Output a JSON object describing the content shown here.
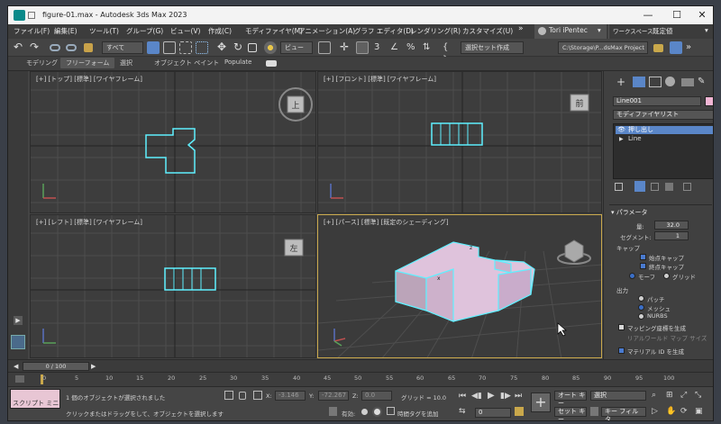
{
  "window": {
    "title": "figure-01.max - Autodesk 3ds Max 2023",
    "minimize": "—",
    "maximize": "☐",
    "close": "✕"
  },
  "menus": [
    "ファイル(F)",
    "編集(E)",
    "ツール(T)",
    "グループ(G)",
    "ビュー(V)",
    "作成(C)",
    "モディファイヤ(M)",
    "アニメーション(A)",
    "グラフ エディタ(D)",
    "レンダリング(R)",
    "カスタマイズ(U)"
  ],
  "menu_overflow": "»",
  "user": {
    "name": "Tori iPentec"
  },
  "workspace": {
    "label": "ワークスペース:",
    "value": "既定値"
  },
  "toolbar": {
    "selection_filter": "すべて",
    "ref_coord": "ビュー",
    "named_selection": "選択セット作成",
    "project_path": "C:\\Storage\\P...dsMax Project"
  },
  "ribbon": {
    "tabs": [
      "モデリング",
      "フリーフォーム",
      "選択",
      "オブジェクト ペイント",
      "Populate"
    ],
    "active": 1
  },
  "viewports": {
    "top": {
      "label": "[+] [トップ] [標準] [ワイヤフレーム]",
      "cube": "上"
    },
    "front": {
      "label": "[+] [フロント] [標準] [ワイヤフレーム]",
      "cube": "前"
    },
    "left": {
      "label": "[+] [レフト] [標準] [ワイヤフレーム]",
      "cube": "左"
    },
    "persp": {
      "label": "[+] [パース] [標準] [既定のシェーディング]"
    }
  },
  "command_panel": {
    "object_name": "Line001",
    "object_color": "#f2b5d4",
    "modifier_list": "モディファイヤリスト",
    "stack": [
      {
        "label": "押し出し",
        "selected": true
      },
      {
        "label": "Line",
        "selected": false
      }
    ],
    "rollout_title": "パラメータ",
    "amount_label": "量:",
    "amount_value": "32.0",
    "segments_label": "セグメント:",
    "segments_value": "1",
    "capping_label": "キャップ",
    "cap_start": "始点キャップ",
    "cap_end": "終点キャップ",
    "morph": "モーフ",
    "grid": "グリッド",
    "output_label": "出力",
    "patch": "パッチ",
    "mesh": "メッシュ",
    "nurbs": "NURBS",
    "gen_mapping": "マッピング座標を生成",
    "real_world": "リアルワールド マップ サイズ",
    "gen_material_id": "マテリアル ID を生成"
  },
  "timeline": {
    "frame": "0 / 100",
    "ticks": [
      "0",
      "5",
      "10",
      "15",
      "20",
      "25",
      "30",
      "35",
      "40",
      "45",
      "50",
      "55",
      "60",
      "65",
      "70",
      "75",
      "80",
      "85",
      "90",
      "95",
      "100"
    ]
  },
  "status": {
    "maxscript": "スクリプト ミニ リス",
    "line1": "1 個のオブジェクトが選択されました",
    "line2": "クリックまたはドラッグをして、オブジェクトを選択します",
    "x_label": "X:",
    "x_value": "-3.146",
    "y_label": "Y:",
    "y_value": "-72.267",
    "z_label": "Z:",
    "z_value": "0.0",
    "grid": "グリッド = 10.0",
    "enabled": "有効:",
    "add_time_tag": "時間タグを追加",
    "auto_key": "オート キー",
    "set_key": "セット キー",
    "selected": "選択",
    "key_filters": "キー フィルタ...",
    "frame_field": "0"
  },
  "colors": {
    "accent": "#c9a84b",
    "selection_wire": "#5ff0ff",
    "object_fill": "#dfc3dc",
    "stack_selected": "#5a86c8"
  }
}
